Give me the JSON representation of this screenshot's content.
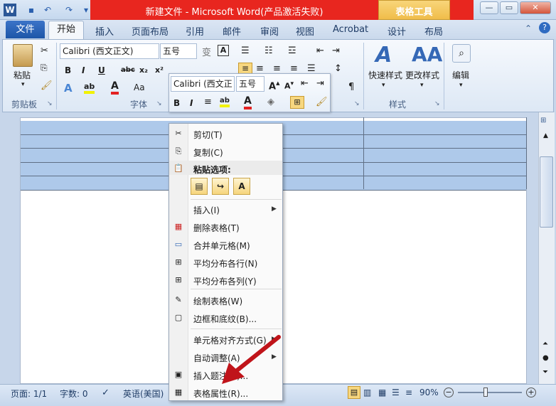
{
  "window": {
    "title": "新建文件  -  Microsoft Word(产品激活失败)",
    "tools_context": "表格工具"
  },
  "tabs": {
    "file": "文件",
    "items": [
      "开始",
      "插入",
      "页面布局",
      "引用",
      "邮件",
      "审阅",
      "视图",
      "Acrobat",
      "设计",
      "布局"
    ]
  },
  "ribbon": {
    "clipboard": {
      "label": "剪贴板",
      "paste": "粘贴"
    },
    "font": {
      "label": "字体",
      "name": "Calibri (西文正文)",
      "size": "五号"
    },
    "styles": {
      "label": "样式",
      "quick": "快速样式",
      "change": "更改样式"
    },
    "editing": {
      "label": "编辑"
    }
  },
  "mini_toolbar": {
    "font": "Calibri (西文正",
    "size": "五号"
  },
  "context_menu": {
    "cut": "剪切(T)",
    "copy": "复制(C)",
    "paste_options": "粘贴选项:",
    "insert": "插入(I)",
    "delete_table": "删除表格(T)",
    "merge": "合并单元格(M)",
    "dist_rows": "平均分布各行(N)",
    "dist_cols": "平均分布各列(Y)",
    "draw_table": "绘制表格(W)",
    "borders": "边框和底纹(B)...",
    "align": "单元格对齐方式(G)",
    "autofit": "自动调整(A)",
    "caption": "插入题注(C)...",
    "props": "表格属性(R)..."
  },
  "status": {
    "page": "页面: 1/1",
    "words": "字数: 0",
    "lang": "英语(美国)",
    "zoom": "90%"
  },
  "colors": {
    "accent": "#e8261f",
    "table_fill": "#aec9ea",
    "arrow": "#c0141a"
  }
}
